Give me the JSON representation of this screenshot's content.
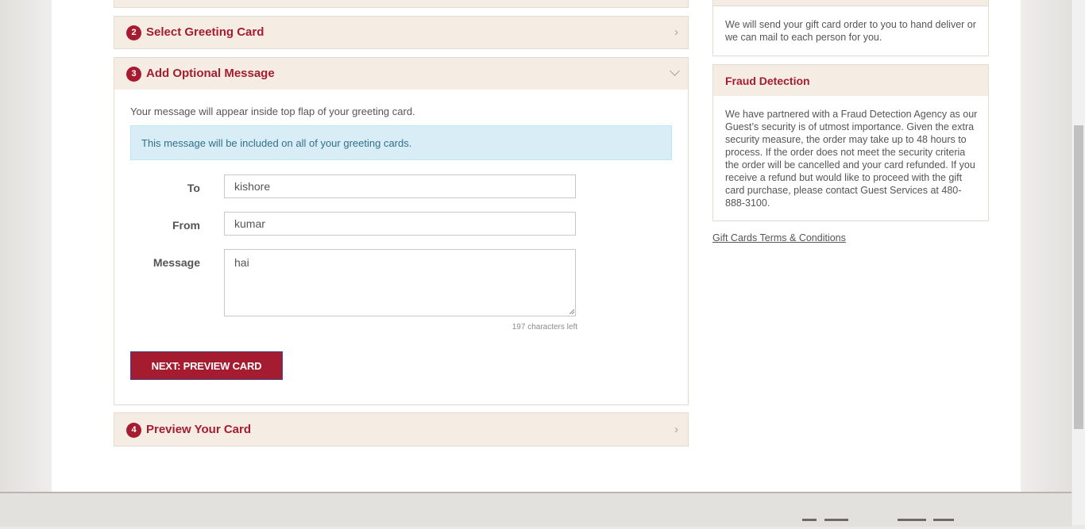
{
  "steps": [
    {
      "number": "2",
      "title": "Select Greeting Card"
    },
    {
      "number": "3",
      "title": "Add Optional Message"
    },
    {
      "number": "4",
      "title": "Preview Your Card"
    }
  ],
  "message_panel": {
    "intro": "Your message will appear inside top flap of your greeting card.",
    "info": "This message will be included on all of your greeting cards.",
    "to_label": "To",
    "to_value": "kishore",
    "from_label": "From",
    "from_value": "kumar",
    "message_label": "Message",
    "message_value": "hai",
    "chars_left": "197 characters left",
    "next_button": "NEXT: PREVIEW CARD"
  },
  "sidebar": {
    "delivery_text": "We will send your gift card order to you to hand deliver or we can mail to each person for you.",
    "fraud_title": "Fraud Detection",
    "fraud_text": "We have partnered with a Fraud Detection Agency as our Guest’s security is of utmost importance. Given the extra security measure, the order may take up to 48 hours to process. If the order does not meet the security criteria the order will be cancelled and your card refunded. If you receive a refund but would like to proceed with the gift card purchase, please contact Guest Services at 480-888-3100.",
    "terms_link": "Gift Cards Terms & Conditions"
  },
  "colors": {
    "accent": "#a51c30",
    "panel_bg": "#f5ede4",
    "info_bg": "#d9edf7",
    "info_text": "#31708f"
  }
}
